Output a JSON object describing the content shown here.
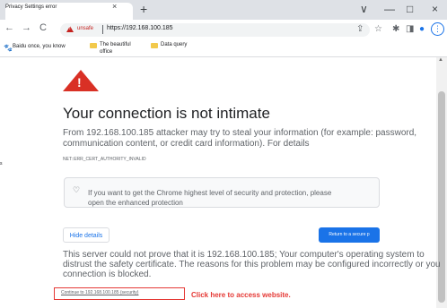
{
  "browser": {
    "tab_title": "Privacy Settings error",
    "tab_close": "×",
    "new_tab": "+",
    "window_controls": [
      "∨",
      "—",
      "□",
      "×"
    ],
    "nav": {
      "back": "←",
      "forward": "→",
      "reload": "C"
    },
    "security_label": "unsafe",
    "url": "https://192.168.100.185",
    "toolbar_icons": {
      "share": "⇪",
      "star": "☆",
      "extensions": "✱",
      "sidebar": "◨",
      "profile": "●",
      "menu": "⋮"
    },
    "bookmarks": {
      "baidu_label": "Baidu once, you know",
      "office_label_line1": "The beautiful",
      "office_label_line2": "office",
      "data_label": "Data query"
    }
  },
  "page": {
    "warning_glyph": "!",
    "heading": "Your connection is not intimate",
    "body": "From 192.168.100.185 attacker may try to steal your information (for example: password, communication content, or credit card information). For details",
    "error_code": "NET::ERR_CERT_AUTHORITY_INVALID",
    "enhanced_icon": "♡",
    "enhanced_protection": "If you want to get the Chrome highest level of security and protection, please open the enhanced protection",
    "hide_details_label": "Hide details",
    "return_label": "Return to a secure p",
    "details_text": "This server could not prove that it is 192.168.100.185; Your computer's operating system to distrust the safety certificate. The reasons for this problem may be configured incorrectly or you connection is blocked.",
    "continue_link": "Continue to 192.168.100.185 (security)",
    "annotation": "Click here to access website.",
    "side_mark": "s"
  },
  "colors": {
    "danger": "#d93025",
    "link": "#1a73e8",
    "annotation": "#e53935"
  }
}
